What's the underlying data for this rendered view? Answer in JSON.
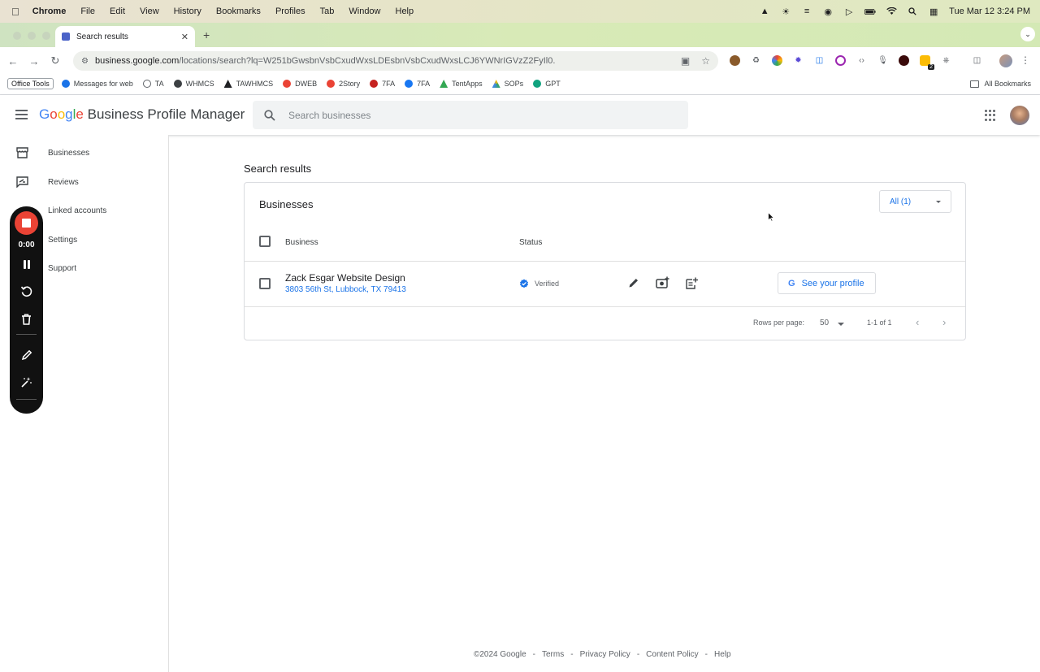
{
  "menubar": {
    "items": [
      "Chrome",
      "File",
      "Edit",
      "View",
      "History",
      "Bookmarks",
      "Profiles",
      "Tab",
      "Window",
      "Help"
    ],
    "clock": "Tue Mar 12  3:24 PM"
  },
  "browser": {
    "tab_title": "Search results",
    "url_host": "business.google.com",
    "url_path": "/locations/search?lq=W251bGwsbnVsbCxudWxsLDEsbnVsbCxudWxsLCJ6YWNrIGVzZ2FyIl0.",
    "extension_badge": "2"
  },
  "bookmarks": {
    "office_tools": "Office Tools",
    "items": [
      {
        "label": "Messages for web",
        "color": "#1a73e8"
      },
      {
        "label": "TA",
        "color": "#5f6368"
      },
      {
        "label": "WHMCS",
        "color": "#3c4043"
      },
      {
        "label": "TAWHMCS",
        "color": "#202124"
      },
      {
        "label": "DWEB",
        "color": "#ea4335"
      },
      {
        "label": "2Story",
        "color": "#ea4335"
      },
      {
        "label": "7FA",
        "color": "#c5221f"
      },
      {
        "label": "7FA",
        "color": "#1877f2"
      },
      {
        "label": "TentApps",
        "color": "#34a853"
      },
      {
        "label": "SOPs",
        "color": "#fbbc05"
      },
      {
        "label": "GPT",
        "color": "#10a37f"
      }
    ],
    "all_bookmarks": "All Bookmarks"
  },
  "header": {
    "product_name": "Business Profile Manager",
    "search_placeholder": "Search businesses"
  },
  "sidebar": {
    "items": [
      {
        "label": "Businesses",
        "icon": "storefront-icon"
      },
      {
        "label": "Reviews",
        "icon": "reviews-icon"
      },
      {
        "label": "Linked accounts",
        "icon": "link-icon"
      },
      {
        "label": "Settings",
        "icon": "settings-icon"
      },
      {
        "label": "Support",
        "icon": "help-icon"
      }
    ]
  },
  "recorder": {
    "time": "0:00"
  },
  "main": {
    "title": "Search results",
    "card_title": "Businesses",
    "filter_value": "All (1)",
    "columns": {
      "business": "Business",
      "status": "Status"
    },
    "rows": [
      {
        "name": "Zack Esgar Website Design",
        "address": "3803 56th St, Lubbock, TX 79413",
        "status": "Verified",
        "action": "See your profile"
      }
    ],
    "rows_per_page_label": "Rows per page:",
    "rows_per_page": "50",
    "range": "1-1 of 1"
  },
  "footer": {
    "copyright": "©2024 Google",
    "sep": "-",
    "links": [
      "Terms",
      "Privacy Policy",
      "Content Policy",
      "Help"
    ]
  },
  "colors": {
    "accent_blue": "#1a73e8",
    "recorder_red": "#ea4335",
    "verified_blue": "#1a73e8"
  }
}
